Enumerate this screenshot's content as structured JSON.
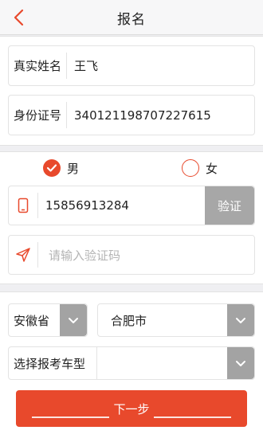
{
  "header": {
    "title": "报名",
    "back_icon": "chevron-left-icon"
  },
  "form": {
    "name_label": "真实姓名",
    "name_value": "王飞",
    "id_label": "身份证号",
    "id_value": "340121198707227615"
  },
  "gender": {
    "male_label": "男",
    "female_label": "女",
    "selected": "男"
  },
  "phone": {
    "icon": "phone-icon",
    "value": "15856913284",
    "verify_label": "验证"
  },
  "code": {
    "icon": "send-icon",
    "placeholder": "请输入验证码"
  },
  "location": {
    "province": "安徽省",
    "city": "合肥市"
  },
  "vehicle": {
    "label": "选择报考车型"
  },
  "next_label": "下一步",
  "colors": {
    "accent": "#e8492c",
    "disabled": "#a7a7a7"
  }
}
